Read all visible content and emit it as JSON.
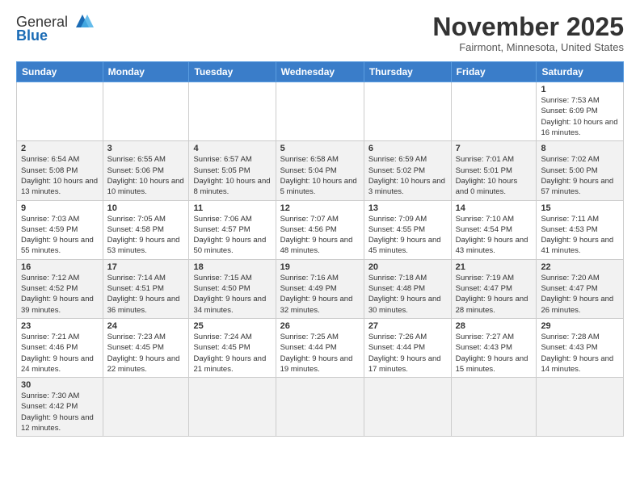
{
  "logo": {
    "general": "General",
    "blue": "Blue"
  },
  "header": {
    "month": "November 2025",
    "location": "Fairmont, Minnesota, United States"
  },
  "weekdays": [
    "Sunday",
    "Monday",
    "Tuesday",
    "Wednesday",
    "Thursday",
    "Friday",
    "Saturday"
  ],
  "weeks": [
    [
      {
        "day": "",
        "info": ""
      },
      {
        "day": "",
        "info": ""
      },
      {
        "day": "",
        "info": ""
      },
      {
        "day": "",
        "info": ""
      },
      {
        "day": "",
        "info": ""
      },
      {
        "day": "",
        "info": ""
      },
      {
        "day": "1",
        "info": "Sunrise: 7:53 AM\nSunset: 6:09 PM\nDaylight: 10 hours and 16 minutes."
      }
    ],
    [
      {
        "day": "2",
        "info": "Sunrise: 6:54 AM\nSunset: 5:08 PM\nDaylight: 10 hours and 13 minutes."
      },
      {
        "day": "3",
        "info": "Sunrise: 6:55 AM\nSunset: 5:06 PM\nDaylight: 10 hours and 10 minutes."
      },
      {
        "day": "4",
        "info": "Sunrise: 6:57 AM\nSunset: 5:05 PM\nDaylight: 10 hours and 8 minutes."
      },
      {
        "day": "5",
        "info": "Sunrise: 6:58 AM\nSunset: 5:04 PM\nDaylight: 10 hours and 5 minutes."
      },
      {
        "day": "6",
        "info": "Sunrise: 6:59 AM\nSunset: 5:02 PM\nDaylight: 10 hours and 3 minutes."
      },
      {
        "day": "7",
        "info": "Sunrise: 7:01 AM\nSunset: 5:01 PM\nDaylight: 10 hours and 0 minutes."
      },
      {
        "day": "8",
        "info": "Sunrise: 7:02 AM\nSunset: 5:00 PM\nDaylight: 9 hours and 57 minutes."
      }
    ],
    [
      {
        "day": "9",
        "info": "Sunrise: 7:03 AM\nSunset: 4:59 PM\nDaylight: 9 hours and 55 minutes."
      },
      {
        "day": "10",
        "info": "Sunrise: 7:05 AM\nSunset: 4:58 PM\nDaylight: 9 hours and 53 minutes."
      },
      {
        "day": "11",
        "info": "Sunrise: 7:06 AM\nSunset: 4:57 PM\nDaylight: 9 hours and 50 minutes."
      },
      {
        "day": "12",
        "info": "Sunrise: 7:07 AM\nSunset: 4:56 PM\nDaylight: 9 hours and 48 minutes."
      },
      {
        "day": "13",
        "info": "Sunrise: 7:09 AM\nSunset: 4:55 PM\nDaylight: 9 hours and 45 minutes."
      },
      {
        "day": "14",
        "info": "Sunrise: 7:10 AM\nSunset: 4:54 PM\nDaylight: 9 hours and 43 minutes."
      },
      {
        "day": "15",
        "info": "Sunrise: 7:11 AM\nSunset: 4:53 PM\nDaylight: 9 hours and 41 minutes."
      }
    ],
    [
      {
        "day": "16",
        "info": "Sunrise: 7:12 AM\nSunset: 4:52 PM\nDaylight: 9 hours and 39 minutes."
      },
      {
        "day": "17",
        "info": "Sunrise: 7:14 AM\nSunset: 4:51 PM\nDaylight: 9 hours and 36 minutes."
      },
      {
        "day": "18",
        "info": "Sunrise: 7:15 AM\nSunset: 4:50 PM\nDaylight: 9 hours and 34 minutes."
      },
      {
        "day": "19",
        "info": "Sunrise: 7:16 AM\nSunset: 4:49 PM\nDaylight: 9 hours and 32 minutes."
      },
      {
        "day": "20",
        "info": "Sunrise: 7:18 AM\nSunset: 4:48 PM\nDaylight: 9 hours and 30 minutes."
      },
      {
        "day": "21",
        "info": "Sunrise: 7:19 AM\nSunset: 4:47 PM\nDaylight: 9 hours and 28 minutes."
      },
      {
        "day": "22",
        "info": "Sunrise: 7:20 AM\nSunset: 4:47 PM\nDaylight: 9 hours and 26 minutes."
      }
    ],
    [
      {
        "day": "23",
        "info": "Sunrise: 7:21 AM\nSunset: 4:46 PM\nDaylight: 9 hours and 24 minutes."
      },
      {
        "day": "24",
        "info": "Sunrise: 7:23 AM\nSunset: 4:45 PM\nDaylight: 9 hours and 22 minutes."
      },
      {
        "day": "25",
        "info": "Sunrise: 7:24 AM\nSunset: 4:45 PM\nDaylight: 9 hours and 21 minutes."
      },
      {
        "day": "26",
        "info": "Sunrise: 7:25 AM\nSunset: 4:44 PM\nDaylight: 9 hours and 19 minutes."
      },
      {
        "day": "27",
        "info": "Sunrise: 7:26 AM\nSunset: 4:44 PM\nDaylight: 9 hours and 17 minutes."
      },
      {
        "day": "28",
        "info": "Sunrise: 7:27 AM\nSunset: 4:43 PM\nDaylight: 9 hours and 15 minutes."
      },
      {
        "day": "29",
        "info": "Sunrise: 7:28 AM\nSunset: 4:43 PM\nDaylight: 9 hours and 14 minutes."
      }
    ],
    [
      {
        "day": "30",
        "info": "Sunrise: 7:30 AM\nSunset: 4:42 PM\nDaylight: 9 hours and 12 minutes."
      },
      {
        "day": "",
        "info": ""
      },
      {
        "day": "",
        "info": ""
      },
      {
        "day": "",
        "info": ""
      },
      {
        "day": "",
        "info": ""
      },
      {
        "day": "",
        "info": ""
      },
      {
        "day": "",
        "info": ""
      }
    ]
  ]
}
